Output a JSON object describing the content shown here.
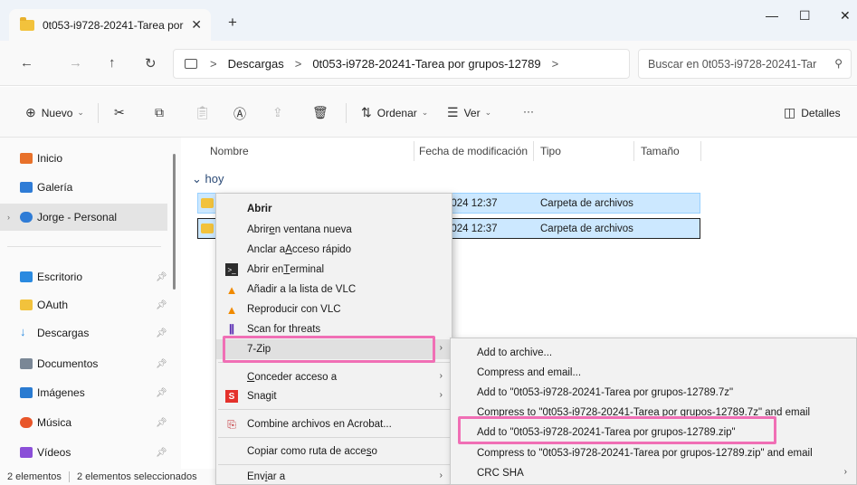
{
  "window": {
    "tab_title": "0t053-i9728-20241-Tarea por g",
    "close_tab_symbol": "✕",
    "new_tab_symbol": "+",
    "minimize_symbol": "—",
    "maximize_symbol": "☐",
    "close_symbol": "✕"
  },
  "address": {
    "back_symbol": "←",
    "forward_symbol": "→",
    "up_symbol": "↑",
    "refresh_symbol": "↻",
    "crumbs": [
      "Descargas",
      "0t053-i9728-20241-Tarea por grupos-12789"
    ],
    "crumb_separator": ">",
    "search_placeholder": "Buscar en 0t053-i9728-20241-Tar",
    "search_symbol": "⚲"
  },
  "toolbar": {
    "new_label": "Nuevo",
    "sort_label": "Ordenar",
    "view_label": "Ver",
    "more_label": "···",
    "details_label": "Detalles"
  },
  "sidebar": {
    "items": [
      {
        "label": "Inicio",
        "color": "#e8712a"
      },
      {
        "label": "Galería",
        "color": "#2f7cd6"
      },
      {
        "label": "Jorge - Personal",
        "color": "#2f7cd6"
      },
      {
        "label": "Escritorio",
        "color": "#2a8ae0"
      },
      {
        "label": "OAuth",
        "color": "#f2c23c"
      },
      {
        "label": "Descargas",
        "color": "#2a8ae0"
      },
      {
        "label": "Documentos",
        "color": "#7a8796"
      },
      {
        "label": "Imágenes",
        "color": "#2a7bd1"
      },
      {
        "label": "Música",
        "color": "#e8562a"
      },
      {
        "label": "Vídeos",
        "color": "#8b4fd8"
      }
    ]
  },
  "content": {
    "columns": [
      "Nombre",
      "Fecha de modificación",
      "Tipo",
      "Tamaño"
    ],
    "group_label": "hoy",
    "rows": [
      {
        "date": "2024 12:37",
        "type": "Carpeta de archivos"
      },
      {
        "date": "2024 12:37",
        "type": "Carpeta de archivos"
      }
    ]
  },
  "status": {
    "count": "2 elementos",
    "selected": "2 elementos seleccionados"
  },
  "context_menu": {
    "open": "Abrir",
    "open_new_window_pre": "Abrir ",
    "open_new_window_u": "e",
    "open_new_window_post": "n ventana nueva",
    "pin_quick_pre": "Anclar a ",
    "pin_quick_u": "A",
    "pin_quick_post": "cceso rápido",
    "open_terminal_pre": "Abrir en ",
    "open_terminal_u": "T",
    "open_terminal_post": "erminal",
    "vlc_add": "Añadir a la lista de VLC",
    "vlc_play": "Reproducir con VLC",
    "scan": "Scan for threats",
    "sevenzip": "7-Zip",
    "grant_pre": "",
    "grant_u": "C",
    "grant_post": "onceder acceso a",
    "snagit": "Snagit",
    "acrobat": "Combine archivos en Acrobat...",
    "copy_path_pre": "Copiar como ruta de acce",
    "copy_path_u": "s",
    "copy_path_post": "o",
    "send_to_pre": "Env",
    "send_to_u": "i",
    "send_to_post": "ar a"
  },
  "submenu": {
    "items": [
      "Add to archive...",
      "Compress and email...",
      "Add to \"0t053-i9728-20241-Tarea por grupos-12789.7z\"",
      "Compress to \"0t053-i9728-20241-Tarea por grupos-12789.7z\" and email",
      "Add to \"0t053-i9728-20241-Tarea por grupos-12789.zip\"",
      "Compress to \"0t053-i9728-20241-Tarea por grupos-12789.zip\" and email",
      "CRC SHA"
    ]
  },
  "colors": {
    "accent_highlight": "#f06fb5",
    "selection": "#cce8ff"
  }
}
